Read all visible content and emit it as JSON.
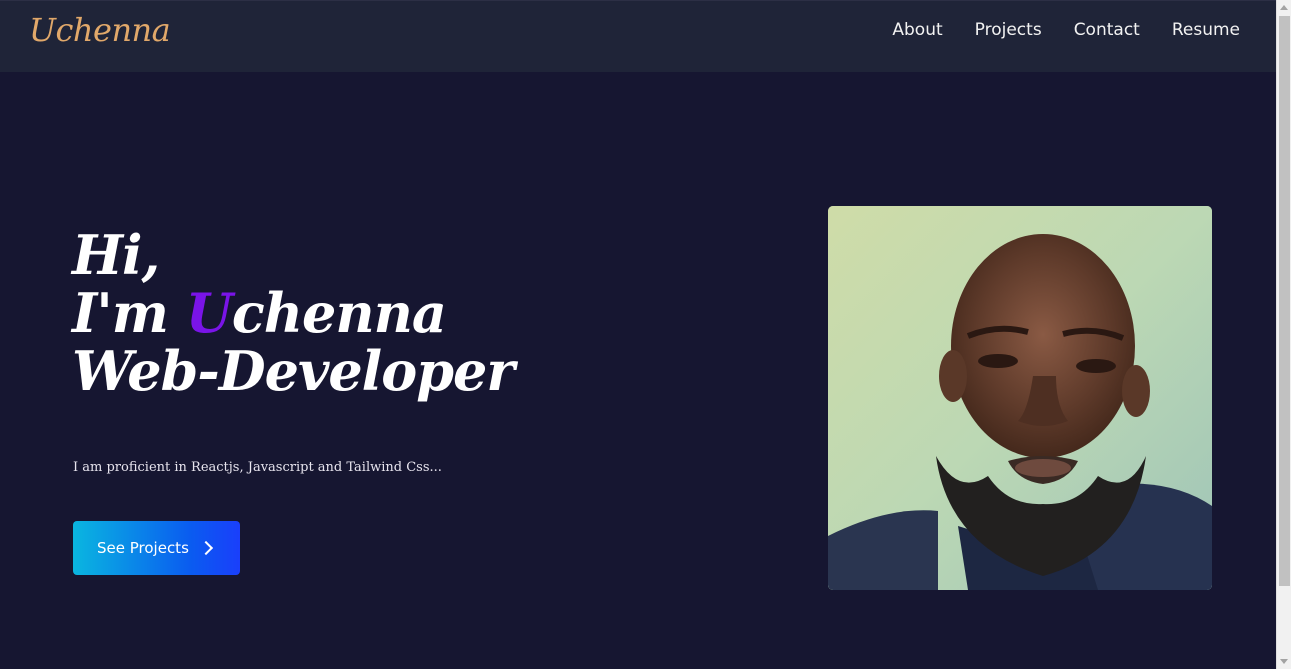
{
  "nav": {
    "logo": "Uchenna",
    "links": [
      "About",
      "Projects",
      "Contact",
      "Resume"
    ]
  },
  "hero": {
    "line1": "Hi,",
    "line2_prefix": "I'm ",
    "line2_accent": "U",
    "line2_rest": "chenna",
    "line3": "Web-Developer",
    "description": "I am proficient in Reactjs, Javascript and Tailwind Css...",
    "cta_label": "See Projects"
  },
  "colors": {
    "background": "#161631",
    "navbar": "#1f2438",
    "logo": "#e1a86a",
    "accent": "#7a14e8",
    "button_start": "#0ab6e0",
    "button_end": "#1a3ffb"
  },
  "icons": {
    "cta_icon": "chevron-right-icon"
  }
}
